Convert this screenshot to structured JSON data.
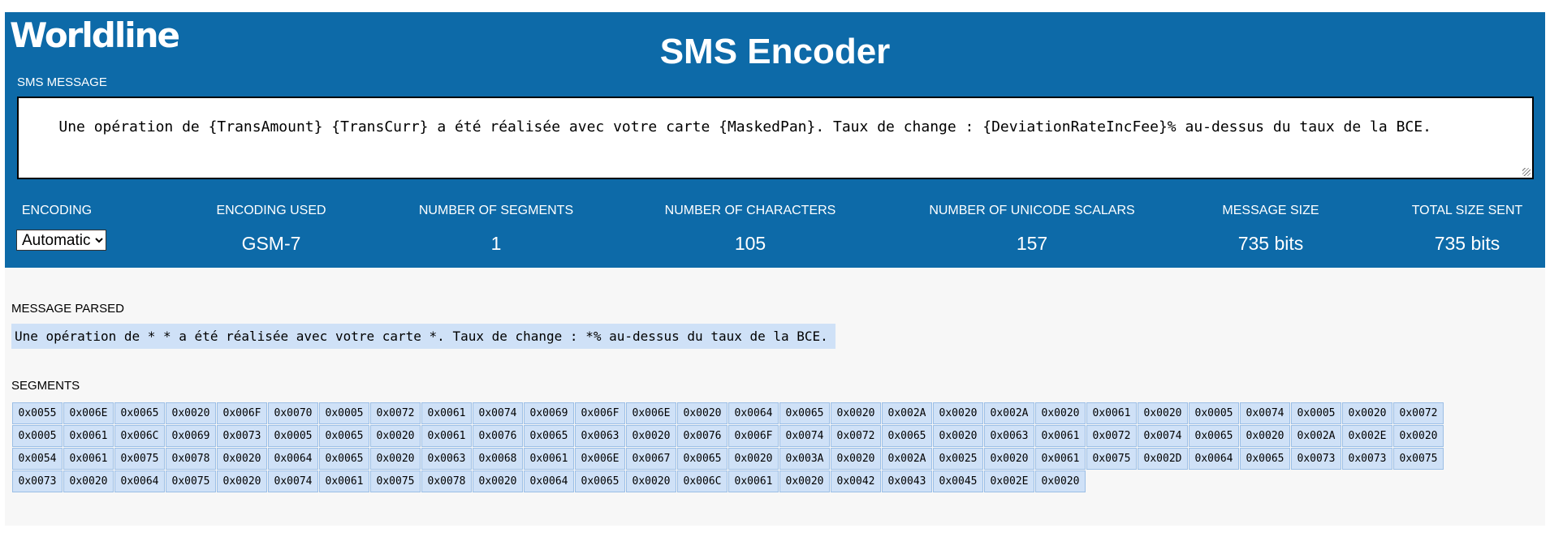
{
  "header": {
    "logo": "Worldline",
    "title": "SMS Encoder",
    "sms_message_label": "SMS MESSAGE",
    "sms_message_value": "Une opération de {TransAmount} {TransCurr} a été réalisée avec votre carte {MaskedPan}. Taux de change : {DeviationRateIncFee}% au-dessus du taux de la BCE."
  },
  "stats": {
    "encoding": {
      "label": "ENCODING",
      "value": "Automatic"
    },
    "encoding_used": {
      "label": "ENCODING USED",
      "value": "GSM-7"
    },
    "segments": {
      "label": "NUMBER OF SEGMENTS",
      "value": "1"
    },
    "characters": {
      "label": "NUMBER OF CHARACTERS",
      "value": "105"
    },
    "unicode_scalars": {
      "label": "NUMBER OF UNICODE SCALARS",
      "value": "157"
    },
    "message_size": {
      "label": "MESSAGE SIZE",
      "value": "735 bits"
    },
    "total_size": {
      "label": "TOTAL SIZE SENT",
      "value": "735 bits"
    }
  },
  "parsed": {
    "label": "MESSAGE PARSED",
    "text": "Une opération de * * a été réalisée avec votre carte *. Taux de change : *% au-dessus du taux de la BCE."
  },
  "segments": {
    "label": "SEGMENTS",
    "codes": [
      "0x0055",
      "0x006E",
      "0x0065",
      "0x0020",
      "0x006F",
      "0x0070",
      "0x0005",
      "0x0072",
      "0x0061",
      "0x0074",
      "0x0069",
      "0x006F",
      "0x006E",
      "0x0020",
      "0x0064",
      "0x0065",
      "0x0020",
      "0x002A",
      "0x0020",
      "0x002A",
      "0x0020",
      "0x0061",
      "0x0020",
      "0x0005",
      "0x0074",
      "0x0005",
      "0x0020",
      "0x0072",
      "0x0005",
      "0x0061",
      "0x006C",
      "0x0069",
      "0x0073",
      "0x0005",
      "0x0065",
      "0x0020",
      "0x0061",
      "0x0076",
      "0x0065",
      "0x0063",
      "0x0020",
      "0x0076",
      "0x006F",
      "0x0074",
      "0x0072",
      "0x0065",
      "0x0020",
      "0x0063",
      "0x0061",
      "0x0072",
      "0x0074",
      "0x0065",
      "0x0020",
      "0x002A",
      "0x002E",
      "0x0020",
      "0x0054",
      "0x0061",
      "0x0075",
      "0x0078",
      "0x0020",
      "0x0064",
      "0x0065",
      "0x0020",
      "0x0063",
      "0x0068",
      "0x0061",
      "0x006E",
      "0x0067",
      "0x0065",
      "0x0020",
      "0x003A",
      "0x0020",
      "0x002A",
      "0x0025",
      "0x0020",
      "0x0061",
      "0x0075",
      "0x002D",
      "0x0064",
      "0x0065",
      "0x0073",
      "0x0073",
      "0x0075",
      "0x0073",
      "0x0020",
      "0x0064",
      "0x0075",
      "0x0020",
      "0x0074",
      "0x0061",
      "0x0075",
      "0x0078",
      "0x0020",
      "0x0064",
      "0x0065",
      "0x0020",
      "0x006C",
      "0x0061",
      "0x0020",
      "0x0042",
      "0x0043",
      "0x0045",
      "0x002E",
      "0x0020"
    ]
  }
}
